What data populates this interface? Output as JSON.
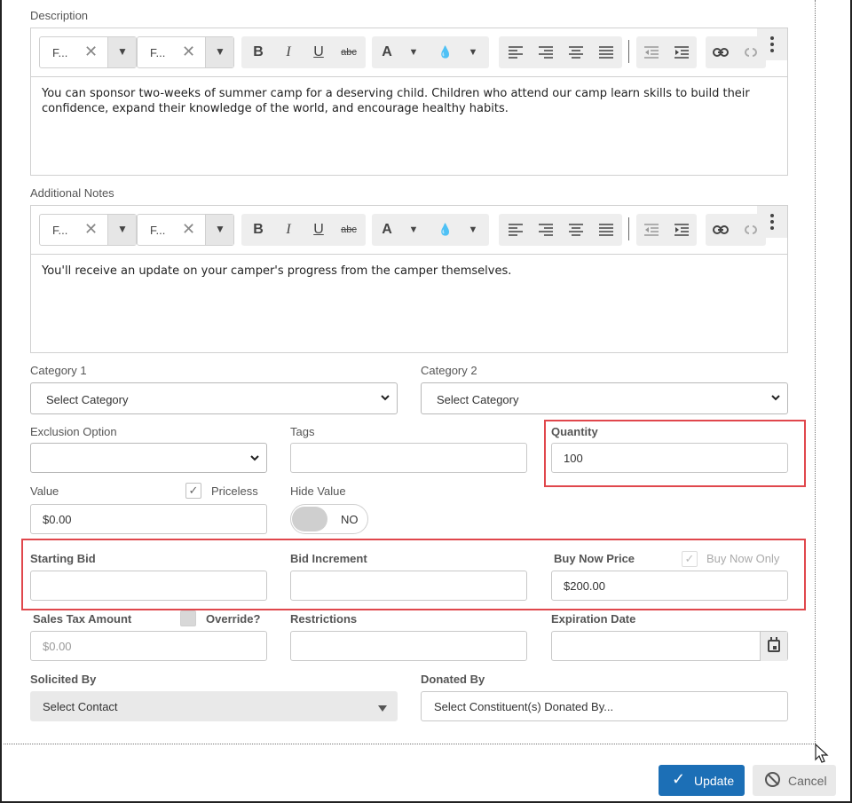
{
  "description": {
    "label": "Description",
    "text": "You can sponsor two-weeks of summer camp for a deserving child. Children who attend our camp learn skills to build their confidence, expand their knowledge of the world, and encourage healthy habits."
  },
  "notes": {
    "label": "Additional Notes",
    "text": "You'll receive an update on your camper's progress from the camper themselves."
  },
  "toolbar": {
    "font_family": "F...",
    "font_size": "F...",
    "bold": "B",
    "italic": "I",
    "underline": "U",
    "strike": "abc",
    "font_color": "A",
    "highlight": "💧",
    "clear": "✕",
    "dropdown": "▼"
  },
  "category1": {
    "label": "Category 1",
    "value": "Select Category"
  },
  "category2": {
    "label": "Category 2",
    "value": "Select Category"
  },
  "exclusion": {
    "label": "Exclusion Option",
    "value": ""
  },
  "tags": {
    "label": "Tags",
    "value": ""
  },
  "quantity": {
    "label": "Quantity",
    "value": "100"
  },
  "value_field": {
    "label": "Value",
    "value": "$0.00",
    "priceless_label": "Priceless",
    "priceless_checked": true
  },
  "hide_value": {
    "label": "Hide Value",
    "toggle_text": "NO"
  },
  "starting_bid": {
    "label": "Starting Bid",
    "value": ""
  },
  "bid_increment": {
    "label": "Bid Increment",
    "value": ""
  },
  "buy_now": {
    "label": "Buy Now Price",
    "value": "$200.00",
    "only_label": "Buy Now Only",
    "only_checked": true
  },
  "sales_tax": {
    "label": "Sales Tax Amount",
    "value": "$0.00",
    "override_label": "Override?"
  },
  "restrictions": {
    "label": "Restrictions",
    "value": ""
  },
  "expiration": {
    "label": "Expiration Date",
    "value": ""
  },
  "solicited_by": {
    "label": "Solicited By",
    "value": "Select Contact"
  },
  "donated_by": {
    "label": "Donated By",
    "placeholder": "Select Constituent(s) Donated By..."
  },
  "actions": {
    "update": "Update",
    "cancel": "Cancel"
  },
  "colors": {
    "accent": "#1c6fb6",
    "highlight_box": "#e0474c"
  }
}
